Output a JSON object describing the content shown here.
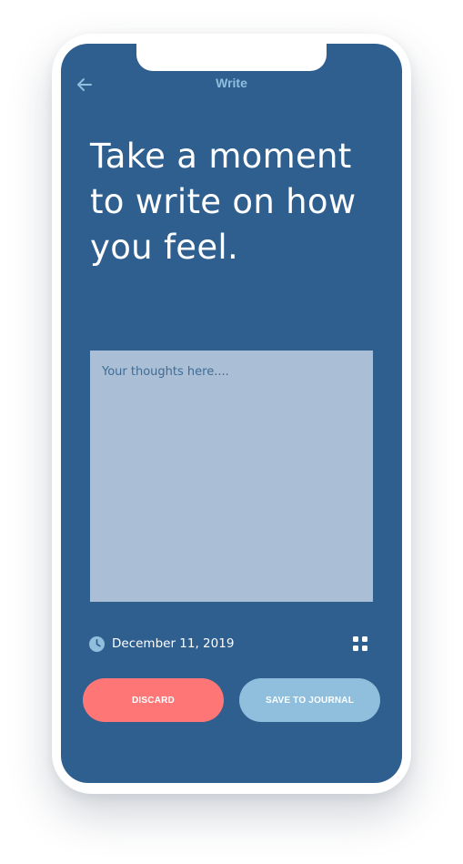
{
  "header": {
    "title": "Write"
  },
  "main": {
    "headline": "Take a moment to write on how you feel.",
    "entry_placeholder": "Your thoughts here....",
    "entry_value": "",
    "date": "December 11, 2019"
  },
  "actions": {
    "discard_label": "DISCARD",
    "save_label": "SAVE TO JOURNAL"
  },
  "icons": {
    "back": "arrow-left-icon",
    "clock": "clock-icon",
    "menu": "grid-icon"
  },
  "colors": {
    "background": "#2f5f8f",
    "accent": "#8fbfdc",
    "input_background": "#aabfd5",
    "discard": "#ff7677",
    "save": "#8fbfdc"
  }
}
